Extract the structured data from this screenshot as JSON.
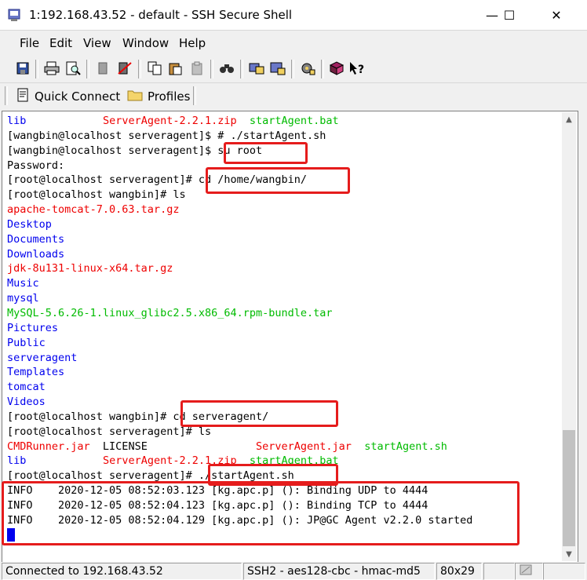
{
  "window": {
    "title": "1:192.168.43.52 - default - SSH Secure Shell",
    "minimize": "—",
    "maximize": "☐",
    "close": "✕"
  },
  "menu": [
    "File",
    "Edit",
    "View",
    "Window",
    "Help"
  ],
  "quickbar": {
    "quick_connect": "Quick Connect",
    "profiles": "Profiles"
  },
  "toolbar_icons": [
    "save-icon",
    "print-icon",
    "print-preview-icon",
    "disconnect-icon",
    "connect-icon",
    "copy-icon",
    "paste-icon",
    "paste-special-icon",
    "find-icon",
    "file-transfer-icon",
    "new-terminal-icon",
    "settings-icon",
    "help-book-icon",
    "context-help-icon"
  ],
  "terminal": {
    "lines": [
      [
        {
          "t": "lib",
          "c": "blue"
        },
        {
          "t": "            "
        },
        {
          "t": "ServerAgent-2.2.1.zip",
          "c": "red"
        },
        {
          "t": "  "
        },
        {
          "t": "startAgent.bat",
          "c": "green"
        }
      ],
      [
        {
          "t": "[wangbin@localhost serveragent]$ # ./startAgent.sh"
        }
      ],
      [
        {
          "t": "[wangbin@localhost serveragent]$ su root"
        }
      ],
      [
        {
          "t": "Password:"
        }
      ],
      [
        {
          "t": "[root@localhost serveragent]# cd /home/wangbin/"
        }
      ],
      [
        {
          "t": "[root@localhost wangbin]# ls"
        }
      ],
      [
        {
          "t": "apache-tomcat-7.0.63.tar.gz",
          "c": "red"
        }
      ],
      [
        {
          "t": "Desktop",
          "c": "blue"
        }
      ],
      [
        {
          "t": "Documents",
          "c": "blue"
        }
      ],
      [
        {
          "t": "Downloads",
          "c": "blue"
        }
      ],
      [
        {
          "t": "jdk-8u131-linux-x64.tar.gz",
          "c": "red"
        }
      ],
      [
        {
          "t": "Music",
          "c": "blue"
        }
      ],
      [
        {
          "t": "mysql",
          "c": "blue"
        }
      ],
      [
        {
          "t": "MySQL-5.6.26-1.linux_glibc2.5.x86_64.rpm-bundle.tar",
          "c": "green"
        }
      ],
      [
        {
          "t": "Pictures",
          "c": "blue"
        }
      ],
      [
        {
          "t": "Public",
          "c": "blue"
        }
      ],
      [
        {
          "t": "serveragent",
          "c": "blue"
        }
      ],
      [
        {
          "t": "Templates",
          "c": "blue"
        }
      ],
      [
        {
          "t": "tomcat",
          "c": "blue"
        }
      ],
      [
        {
          "t": "Videos",
          "c": "blue"
        }
      ],
      [
        {
          "t": "[root@localhost wangbin]# cd serveragent/"
        }
      ],
      [
        {
          "t": "[root@localhost serveragent]# ls"
        }
      ],
      [
        {
          "t": "CMDRunner.jar",
          "c": "red"
        },
        {
          "t": "  LICENSE                 "
        },
        {
          "t": "ServerAgent.jar",
          "c": "red"
        },
        {
          "t": "  "
        },
        {
          "t": "startAgent.sh",
          "c": "green"
        }
      ],
      [
        {
          "t": "lib",
          "c": "blue"
        },
        {
          "t": "            "
        },
        {
          "t": "ServerAgent-2.2.1.zip",
          "c": "red"
        },
        {
          "t": "  "
        },
        {
          "t": "startAgent.bat",
          "c": "green"
        }
      ],
      [
        {
          "t": "[root@localhost serveragent]# ./startAgent.sh"
        }
      ],
      [
        {
          "t": "INFO    2020-12-05 08:52:03.123 [kg.apc.p] (): Binding UDP to 4444"
        }
      ],
      [
        {
          "t": "INFO    2020-12-05 08:52:04.123 [kg.apc.p] (): Binding TCP to 4444"
        }
      ],
      [
        {
          "t": "INFO    2020-12-05 08:52:04.129 [kg.apc.p] (): JP@GC Agent v2.2.0 started"
        }
      ],
      [
        {
          "cursor": true
        }
      ]
    ]
  },
  "status": {
    "connection": "Connected to 192.168.43.52",
    "cipher": "SSH2 - aes128-cbc - hmac-md5",
    "size": "80x29"
  },
  "colors": {
    "blue": "#0000ee",
    "red": "#ee0000",
    "green": "#00bb00",
    "highlight": "#e51c1c"
  }
}
